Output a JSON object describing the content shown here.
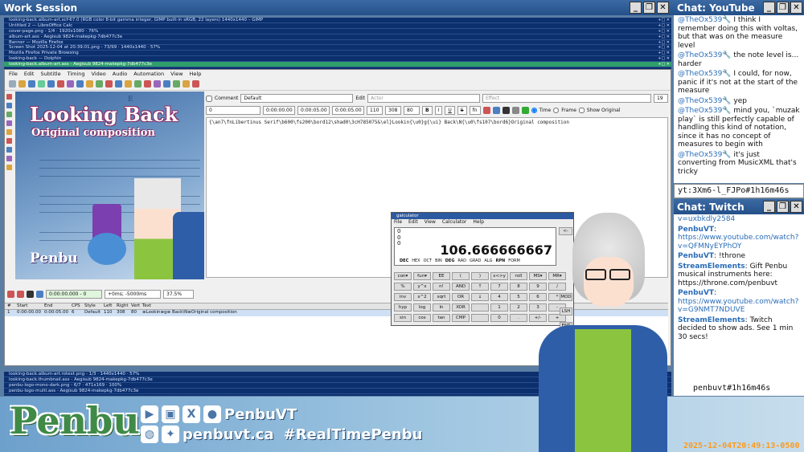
{
  "workspace": {
    "title": "Work Session"
  },
  "window_controls": {
    "minimize": "_",
    "restore": "❐",
    "close": "✕"
  },
  "tasks": [
    "looking-back.album-art.xcf-67.0 (RGB color 8-bit gamma integer, GIMP built-in sRGB, 22 layers) 1440x1440 – GIMP",
    "Untitled 2 — LibreOffice Calc",
    "cover-page.png - 1/4 · 1920x1080 · 76%",
    "album-art.ass - Aegisub 9824-makepkg-7db477c3e",
    "Banner — Mozilla Firefox",
    "Screen Shot 2025-12-04 at 20:39:01.png - 73/99 · 1440x1440 · 57%",
    "Mozilla Firefox Private Browsing",
    "looking-back — Dolphin",
    "looking-back.album-art.ass - Aegisub 9824-makepkg-7db477c3e"
  ],
  "task_ctl": "+□ ✕",
  "aegisub": {
    "menu": [
      "File",
      "Edit",
      "Subtitle",
      "Timing",
      "Video",
      "Audio",
      "Automation",
      "View",
      "Help"
    ],
    "comment_label": "Comment",
    "style": "Default",
    "edit_label": "Edit",
    "actor_placeholder": "Actor",
    "effect_placeholder": "Effect",
    "line_length": "19",
    "layer": "0",
    "start": "0:00:00.00",
    "end": "0:00:05.00",
    "duration": "0:00:05.00",
    "margin_l": "110",
    "margin_r": "308",
    "margin_v": "80",
    "time_label": "Time",
    "frame_label": "Frame",
    "show_original": "Show Original",
    "bold": "B",
    "italic": "I",
    "underline": "U",
    "strike": "S",
    "fontbtn": "fn",
    "text": "{\\an7\\fnLibertinus Serif\\b600\\fs200\\bord12\\shad0\\3cH785075&\\el}Lookin{\\u0}g{\\ui} Back\\N{\\u0\\fs107\\bord6}Original composition",
    "video": {
      "title": "Looking Back",
      "subtitle": "Original composition",
      "logo": "Penbu",
      "note": "E"
    },
    "play_time": "0:00:00.000 - 0",
    "play_offset": "+0ms; -5000ms",
    "zoom": "37.5%",
    "grid_headers": [
      "#",
      "Start",
      "End",
      "CPS",
      "Style",
      "Left",
      "Right",
      "Vert",
      "Text"
    ],
    "grid_row": [
      "1",
      "0:00:00.00",
      "0:00:05.00",
      "6",
      "Default",
      "110",
      "308",
      "80",
      "≡Lookin≡g≡ Back\\N≡Original composition"
    ]
  },
  "calculator": {
    "title": "galculator",
    "menu": [
      "File",
      "Edit",
      "View",
      "Calculator",
      "Help"
    ],
    "stack": [
      "0",
      "0",
      "0"
    ],
    "value": "106.666666667",
    "modes_left": [
      "DEC",
      "HEX",
      "OCT",
      "BIN"
    ],
    "modes_right": [
      "DEG",
      "RAD",
      "GRAD",
      "ALG",
      "RPN",
      "FORM"
    ],
    "buttons": [
      "con▾",
      "fun▾",
      "EE",
      "(",
      ")",
      "x<>y",
      "roll",
      "MS▾",
      "MR▾",
      "%",
      "y^x",
      "n!",
      "AND",
      "↑",
      "7",
      "8",
      "9",
      "/",
      "inv",
      "x^2",
      "sqrt",
      "OR",
      "↓",
      "4",
      "5",
      "6",
      "*",
      "hyp",
      "log",
      "ln",
      "XOR",
      "",
      "1",
      "2",
      "3",
      "-",
      "sin",
      "cos",
      "tan",
      "CMP",
      "",
      "0",
      ".",
      "+/-",
      "+"
    ],
    "side": [
      "<-",
      "MOD",
      "LSH",
      "ENT"
    ]
  },
  "recent_tasks": [
    "looking-back.album-art.rotext.png - 1/3 · 1440x1440 · 57%",
    "looking-back.thumbnail.ass - Aegisub 9824-makepkg-7db477c3e",
    "penbu-logo-mono-dark.png - 6/7 · 471x169 · 100%",
    "penbu-logo-multi.ass - Aegisub 9824-makepkg-7db477c3e"
  ],
  "banner": {
    "logo": "Penbu",
    "handle": "PenbuVT",
    "site": "penbuvt.ca",
    "hashtag": "#RealTimePenbu",
    "icons": [
      "youtube-icon",
      "twitch-icon",
      "x-icon",
      "github-icon",
      "globe-icon",
      "bluesky-icon"
    ]
  },
  "timestamp": "2025-12-04T20:49:13-0500",
  "youtube": {
    "title": "Chat: YouTube",
    "id": "yt:3Xm6-l_FJPo#1h16m46s",
    "messages": [
      {
        "user": "@TheOx539",
        "text": "I think I remember doing this with voltas, but that was on the measure level"
      },
      {
        "user": "@TheOx539",
        "text": "the note level is... harder"
      },
      {
        "user": "@TheOx539",
        "text": "I could, for now, panic if it's not at the start of the measure"
      },
      {
        "user": "@TheOx539",
        "text": "yep"
      },
      {
        "user": "@TheOx539",
        "text": "mind you, `muzak play` is still perfectly capable of handling this kind of notation, since it has no concept of measures to begin with"
      },
      {
        "user": "@TheOx539",
        "text": "it's just converting from MusicXML that's tricky"
      }
    ]
  },
  "twitch": {
    "title": "Chat: Twitch",
    "id": "penbuvt#1h16m46s",
    "top_link": "v=uxbkdly2584",
    "messages": [
      {
        "user": "PenbuVT",
        "text": "https://www.youtube.com/watch?v=QFMNyEYPhOY",
        "link": true
      },
      {
        "user": "PenbuVT",
        "text": "!throne",
        "link": false
      },
      {
        "user": "StreamElements",
        "text": "Gift Penbu musical instruments here: https://throne.com/penbuvt",
        "link": false
      },
      {
        "user": "PenbuVT",
        "text": "https://www.youtube.com/watch?v=G9NMT7NDUVE",
        "link": true
      },
      {
        "user": "StreamElements",
        "text": "Twitch decided to show ads. See 1 min 30 secs!",
        "link": false
      }
    ]
  },
  "colors": {
    "accent": "#2a6db8",
    "titlebar": "#24508a",
    "active_task": "#2e9f6a",
    "logo_green": "#3f8a47",
    "timestamp": "#ff9a1a"
  }
}
